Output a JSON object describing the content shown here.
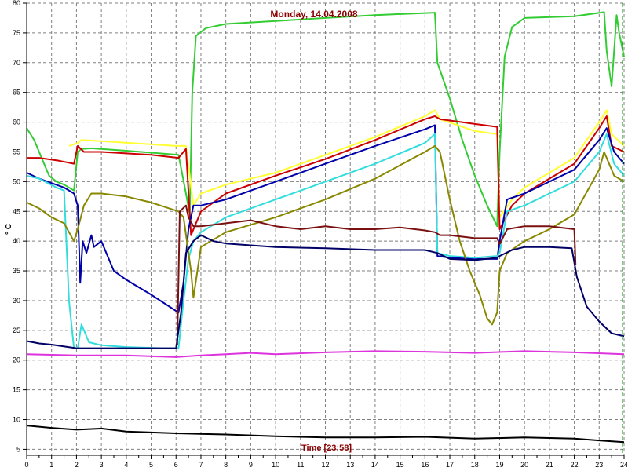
{
  "chart_data": {
    "type": "line",
    "title": "Monday, 14.04.2008",
    "xlabel": "Time [23:58]",
    "ylabel": "° C",
    "xlim": [
      0,
      24
    ],
    "ylim": [
      4,
      80
    ],
    "x_ticks": [
      "0",
      "1",
      "2",
      "3",
      "4",
      "5",
      "6",
      "7",
      "8",
      "9",
      "10",
      "11",
      "12",
      "13",
      "14",
      "15",
      "16",
      "17",
      "18",
      "19",
      "20",
      "21",
      "22",
      "23",
      "24"
    ],
    "y_ticks": [
      "5",
      "10",
      "15",
      "20",
      "25",
      "30",
      "35",
      "40",
      "45",
      "50",
      "55",
      "60",
      "65",
      "70",
      "75",
      "80"
    ],
    "grid": true,
    "series": [
      {
        "color": "#33cc33",
        "points": [
          [
            0,
            59
          ],
          [
            0.3,
            57
          ],
          [
            0.6,
            54
          ],
          [
            0.9,
            51
          ],
          [
            1.2,
            50
          ],
          [
            1.5,
            49.5
          ],
          [
            1.9,
            48.5
          ],
          [
            2.05,
            55
          ],
          [
            2.2,
            55.5
          ],
          [
            2.6,
            55.6
          ],
          [
            4,
            55.2
          ],
          [
            5.5,
            54.7
          ],
          [
            6.1,
            54.5
          ],
          [
            6.4,
            48
          ],
          [
            6.55,
            44.5
          ],
          [
            6.65,
            65
          ],
          [
            6.8,
            74.5
          ],
          [
            7.2,
            75.8
          ],
          [
            8,
            76.5
          ],
          [
            10,
            77
          ],
          [
            12,
            77.5
          ],
          [
            14,
            78
          ],
          [
            16.4,
            78.4
          ],
          [
            16.5,
            70
          ],
          [
            17,
            64
          ],
          [
            17.5,
            57
          ],
          [
            18,
            51
          ],
          [
            18.5,
            46
          ],
          [
            18.9,
            42.5
          ],
          [
            19,
            55
          ],
          [
            19.2,
            71
          ],
          [
            19.5,
            76
          ],
          [
            20,
            77.5
          ],
          [
            22,
            77.8
          ],
          [
            23.2,
            78.5
          ],
          [
            23.3,
            72
          ],
          [
            23.5,
            66
          ],
          [
            23.7,
            78
          ],
          [
            23.8,
            75
          ],
          [
            24,
            71
          ]
        ]
      },
      {
        "color": "#ffff33",
        "points": [
          [
            1.7,
            56
          ],
          [
            2.05,
            56.5
          ],
          [
            2.2,
            57
          ],
          [
            3,
            56.8
          ],
          [
            6,
            56
          ],
          [
            6.4,
            56
          ],
          [
            6.7,
            46
          ],
          [
            7,
            48
          ],
          [
            8,
            49.5
          ],
          [
            10,
            51.5
          ],
          [
            12,
            54.5
          ],
          [
            14,
            57.5
          ],
          [
            16,
            61
          ],
          [
            16.4,
            62
          ],
          [
            16.6,
            60.5
          ],
          [
            18,
            58.5
          ],
          [
            18.9,
            58
          ],
          [
            19,
            44
          ],
          [
            19.5,
            47
          ],
          [
            20,
            49
          ],
          [
            21,
            51.5
          ],
          [
            22,
            54
          ],
          [
            23,
            60
          ],
          [
            23.3,
            62
          ],
          [
            23.5,
            58
          ],
          [
            24,
            56
          ]
        ]
      },
      {
        "color": "#cc0000",
        "points": [
          [
            0,
            54
          ],
          [
            0.5,
            54
          ],
          [
            1.3,
            53.5
          ],
          [
            1.9,
            53
          ],
          [
            2.05,
            56
          ],
          [
            2.3,
            55
          ],
          [
            3,
            55
          ],
          [
            5,
            54.5
          ],
          [
            6.1,
            54
          ],
          [
            6.4,
            55.5
          ],
          [
            6.6,
            41
          ],
          [
            7,
            45
          ],
          [
            8,
            48
          ],
          [
            10,
            51
          ],
          [
            12,
            53.8
          ],
          [
            14,
            57
          ],
          [
            16,
            60.5
          ],
          [
            16.4,
            61
          ],
          [
            16.6,
            60.5
          ],
          [
            18,
            59.7
          ],
          [
            18.9,
            59.2
          ],
          [
            19,
            42
          ],
          [
            19.5,
            46
          ],
          [
            20,
            48
          ],
          [
            21,
            50.5
          ],
          [
            22,
            53
          ],
          [
            23,
            59
          ],
          [
            23.3,
            61
          ],
          [
            23.5,
            56
          ],
          [
            24,
            55
          ]
        ]
      },
      {
        "color": "#0000aa",
        "points": [
          [
            0,
            51.5
          ],
          [
            0.5,
            50.5
          ],
          [
            1.5,
            49
          ],
          [
            1.9,
            48
          ],
          [
            2.05,
            46
          ],
          [
            2.15,
            33
          ],
          [
            2.25,
            40
          ],
          [
            2.4,
            38
          ],
          [
            2.6,
            41
          ],
          [
            2.7,
            39
          ],
          [
            3,
            40
          ],
          [
            3.5,
            35
          ],
          [
            4,
            33.5
          ],
          [
            5,
            31
          ],
          [
            6.1,
            28
          ],
          [
            6.3,
            33
          ],
          [
            6.5,
            42
          ],
          [
            6.7,
            46
          ],
          [
            7,
            46
          ],
          [
            8,
            47
          ],
          [
            10,
            50
          ],
          [
            12,
            53
          ],
          [
            14,
            56
          ],
          [
            16,
            58.8
          ],
          [
            16.4,
            59.5
          ],
          [
            16.5,
            37.5
          ],
          [
            17,
            37.2
          ],
          [
            18,
            37
          ],
          [
            18.9,
            37
          ],
          [
            19,
            40
          ],
          [
            19.3,
            47
          ],
          [
            20,
            48
          ],
          [
            21,
            50
          ],
          [
            22,
            52
          ],
          [
            23,
            57
          ],
          [
            23.3,
            59
          ],
          [
            23.6,
            55
          ],
          [
            24,
            53
          ]
        ]
      },
      {
        "color": "#33dddd",
        "points": [
          [
            0,
            51
          ],
          [
            0.5,
            50.5
          ],
          [
            1.2,
            49
          ],
          [
            1.5,
            48.5
          ],
          [
            1.7,
            30
          ],
          [
            1.9,
            22
          ],
          [
            2.05,
            22
          ],
          [
            2.2,
            26
          ],
          [
            2.5,
            23
          ],
          [
            3,
            22.5
          ],
          [
            4,
            22.2
          ],
          [
            5.5,
            22
          ],
          [
            6.1,
            22
          ],
          [
            6.3,
            30
          ],
          [
            6.5,
            37
          ],
          [
            6.7,
            40
          ],
          [
            7,
            41.5
          ],
          [
            8,
            44
          ],
          [
            10,
            47
          ],
          [
            12,
            50
          ],
          [
            14,
            53
          ],
          [
            16,
            56.5
          ],
          [
            16.4,
            58
          ],
          [
            16.5,
            38
          ],
          [
            17,
            37.5
          ],
          [
            18,
            37.2
          ],
          [
            18.9,
            37.5
          ],
          [
            19,
            38
          ],
          [
            19.3,
            45
          ],
          [
            20,
            46
          ],
          [
            21,
            48
          ],
          [
            22,
            50
          ],
          [
            23,
            55
          ],
          [
            23.3,
            58
          ],
          [
            23.6,
            53
          ],
          [
            24,
            51
          ]
        ]
      },
      {
        "color": "#888800",
        "points": [
          [
            0,
            46.5
          ],
          [
            0.5,
            45.5
          ],
          [
            1,
            44
          ],
          [
            1.5,
            43
          ],
          [
            1.9,
            40
          ],
          [
            2.05,
            42
          ],
          [
            2.3,
            46
          ],
          [
            2.6,
            48
          ],
          [
            3,
            48
          ],
          [
            4,
            47.5
          ],
          [
            5,
            46.5
          ],
          [
            6.1,
            45
          ],
          [
            6.3,
            44
          ],
          [
            6.6,
            35
          ],
          [
            6.7,
            30.5
          ],
          [
            7,
            39
          ],
          [
            8,
            41.5
          ],
          [
            10,
            44
          ],
          [
            12,
            47
          ],
          [
            14,
            50.5
          ],
          [
            16,
            55
          ],
          [
            16.4,
            56
          ],
          [
            16.6,
            55
          ],
          [
            17,
            47
          ],
          [
            17.4,
            40
          ],
          [
            17.8,
            35
          ],
          [
            18.2,
            31
          ],
          [
            18.5,
            27
          ],
          [
            18.7,
            26
          ],
          [
            18.9,
            28
          ],
          [
            19,
            35
          ],
          [
            19.3,
            38
          ],
          [
            20,
            40
          ],
          [
            21,
            42
          ],
          [
            22,
            44.5
          ],
          [
            23,
            52
          ],
          [
            23.2,
            55
          ],
          [
            23.6,
            51
          ],
          [
            24,
            50
          ]
        ]
      },
      {
        "color": "#7a1010",
        "points": [
          [
            6.05,
            22.5
          ],
          [
            6.15,
            45
          ],
          [
            6.4,
            46
          ],
          [
            6.5,
            44
          ],
          [
            6.7,
            42.5
          ],
          [
            7,
            42.5
          ],
          [
            8,
            43
          ],
          [
            9,
            43.5
          ],
          [
            10,
            42.5
          ],
          [
            11,
            42
          ],
          [
            12,
            42.5
          ],
          [
            13,
            42
          ],
          [
            14,
            42
          ],
          [
            15,
            42.3
          ],
          [
            16,
            41.8
          ],
          [
            16.4,
            41.5
          ],
          [
            16.6,
            41
          ],
          [
            17,
            41
          ],
          [
            18,
            40.5
          ],
          [
            18.9,
            40.5
          ],
          [
            19,
            39.5
          ],
          [
            19.3,
            42
          ],
          [
            20,
            42.5
          ],
          [
            21,
            42.5
          ],
          [
            22,
            42
          ],
          [
            22.05,
            36
          ]
        ]
      },
      {
        "color": "#000066",
        "points": [
          [
            0,
            23.2
          ],
          [
            0.5,
            22.8
          ],
          [
            1,
            22.6
          ],
          [
            2,
            22
          ],
          [
            3,
            22
          ],
          [
            4,
            22
          ],
          [
            5,
            22
          ],
          [
            6,
            22
          ],
          [
            6.2,
            28
          ],
          [
            6.4,
            38
          ],
          [
            6.7,
            40
          ],
          [
            7,
            41
          ],
          [
            7.5,
            40
          ],
          [
            8,
            39.6
          ],
          [
            10,
            39
          ],
          [
            12,
            38.8
          ],
          [
            14,
            38.5
          ],
          [
            16,
            38.5
          ],
          [
            16.5,
            38
          ],
          [
            17,
            37
          ],
          [
            18,
            36.8
          ],
          [
            18.9,
            37.2
          ],
          [
            19,
            37.5
          ],
          [
            19.5,
            38.5
          ],
          [
            20,
            39
          ],
          [
            21,
            39
          ],
          [
            21.9,
            38.8
          ],
          [
            22.1,
            34
          ],
          [
            22.5,
            29
          ],
          [
            23,
            26.5
          ],
          [
            23.5,
            24.5
          ],
          [
            24,
            24
          ]
        ]
      },
      {
        "color": "#dd33dd",
        "points": [
          [
            0,
            21
          ],
          [
            2,
            20.8
          ],
          [
            4,
            20.8
          ],
          [
            6,
            20.5
          ],
          [
            7,
            20.8
          ],
          [
            8,
            21
          ],
          [
            9,
            21.2
          ],
          [
            10,
            21
          ],
          [
            12,
            21.3
          ],
          [
            14,
            21.5
          ],
          [
            16,
            21.4
          ],
          [
            18,
            21.2
          ],
          [
            20,
            21.5
          ],
          [
            22,
            21.3
          ],
          [
            24,
            21
          ]
        ]
      },
      {
        "color": "#000000",
        "points": [
          [
            0,
            9
          ],
          [
            1,
            8.6
          ],
          [
            2,
            8.3
          ],
          [
            3,
            8.5
          ],
          [
            4,
            8
          ],
          [
            6,
            7.7
          ],
          [
            8,
            7.5
          ],
          [
            10,
            7.2
          ],
          [
            12,
            7
          ],
          [
            14,
            7
          ],
          [
            16,
            7.1
          ],
          [
            18,
            6.8
          ],
          [
            20,
            7
          ],
          [
            22,
            6.8
          ],
          [
            23,
            6.5
          ],
          [
            24,
            6.2
          ]
        ]
      }
    ]
  }
}
